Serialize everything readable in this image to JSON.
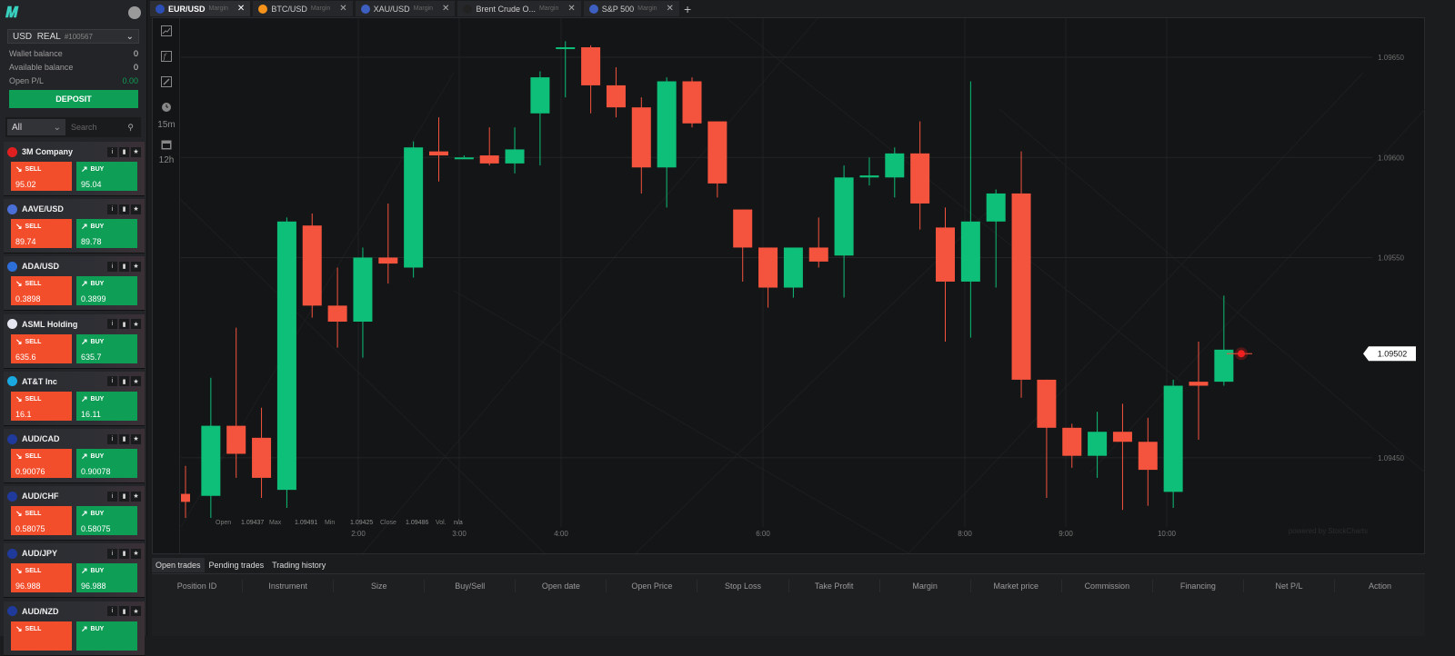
{
  "sidebar": {
    "account": {
      "currency": "USD",
      "type": "REAL",
      "id": "#100567"
    },
    "wallet_balance_label": "Wallet balance",
    "wallet_balance": "0",
    "available_balance_label": "Available balance",
    "available_balance": "0",
    "open_pl_label": "Open P/L",
    "open_pl": "0.00",
    "deposit_label": "DEPOSIT",
    "filter": "All",
    "search_placeholder": "Search",
    "instruments": [
      {
        "name": "3M Company",
        "sell": "95.02",
        "buy": "95.04",
        "flag_color": "#e02020"
      },
      {
        "name": "AAVE/USD",
        "sell": "89.74",
        "buy": "89.78",
        "flag_color": "#4a6fd6"
      },
      {
        "name": "ADA/USD",
        "sell": "0.3898",
        "buy": "0.3899",
        "flag_color": "#2c6fd9"
      },
      {
        "name": "ASML Holding",
        "sell": "635.6",
        "buy": "635.7",
        "flag_color": "#e6e6f0"
      },
      {
        "name": "AT&T Inc",
        "sell": "16.1",
        "buy": "16.11",
        "flag_color": "#19a8e0"
      },
      {
        "name": "AUD/CAD",
        "sell": "0.90076",
        "buy": "0.90078",
        "flag_color": "#1f3a9a"
      },
      {
        "name": "AUD/CHF",
        "sell": "0.58075",
        "buy": "0.58075",
        "flag_color": "#1f3a9a"
      },
      {
        "name": "AUD/JPY",
        "sell": "96.988",
        "buy": "96.988",
        "flag_color": "#1f3a9a"
      },
      {
        "name": "AUD/NZD",
        "sell": "",
        "buy": "",
        "flag_color": "#1f3a9a"
      }
    ],
    "sell_label": "SELL",
    "buy_label": "BUY"
  },
  "tabs": [
    {
      "label": "EUR/USD",
      "sub": "Margin",
      "flag_color": "#2c4fb5",
      "active": true
    },
    {
      "label": "BTC/USD",
      "sub": "Margin",
      "flag_color": "#f7931a",
      "active": false
    },
    {
      "label": "XAU/USD",
      "sub": "Margin",
      "flag_color": "#3c5fc0",
      "active": false
    },
    {
      "label": "Brent Crude O...",
      "sub": "Margin",
      "flag_color": "#222",
      "active": false
    },
    {
      "label": "S&P 500",
      "sub": "Margin",
      "flag_color": "#3c5fc0",
      "active": false
    }
  ],
  "toolbar": {
    "interval_1": "15m",
    "interval_2": "12h"
  },
  "chart_data": {
    "type": "candlestick",
    "y_ticks": [
      1.0945,
      1.0955,
      1.096,
      1.0965
    ],
    "y_tick_labels": [
      "1.09450",
      "1.09550",
      "1.09600",
      "1.09650"
    ],
    "x_ticks": [
      "2:00",
      "3:00",
      "4:00",
      "6:00",
      "8:00",
      "9:00",
      "10:00"
    ],
    "current_price": "1.09502",
    "ohlc_labels": {
      "open": "Open",
      "max": "Max",
      "min": "Min",
      "close": "Close",
      "vol": "Vol."
    },
    "ohlc_values": {
      "open": "1.09437",
      "max": "1.09491",
      "min": "1.09425",
      "close": "1.09486",
      "vol": "n/a"
    },
    "watermark": "powered by StockCharts",
    "candles": [
      {
        "o": 1.09432,
        "h": 1.09446,
        "l": 1.0942,
        "c": 1.09428
      },
      {
        "o": 1.09431,
        "h": 1.0949,
        "l": 1.0942,
        "c": 1.09466
      },
      {
        "o": 1.09466,
        "h": 1.09515,
        "l": 1.0944,
        "c": 1.09452
      },
      {
        "o": 1.0946,
        "h": 1.09475,
        "l": 1.0943,
        "c": 1.0944
      },
      {
        "o": 1.09434,
        "h": 1.0957,
        "l": 1.09425,
        "c": 1.09568
      },
      {
        "o": 1.09566,
        "h": 1.09572,
        "l": 1.0952,
        "c": 1.09526
      },
      {
        "o": 1.09526,
        "h": 1.09545,
        "l": 1.09505,
        "c": 1.09518
      },
      {
        "o": 1.09518,
        "h": 1.09555,
        "l": 1.095,
        "c": 1.0955
      },
      {
        "o": 1.0955,
        "h": 1.09577,
        "l": 1.09537,
        "c": 1.09547
      },
      {
        "o": 1.09545,
        "h": 1.09608,
        "l": 1.0954,
        "c": 1.09605
      },
      {
        "o": 1.09603,
        "h": 1.0962,
        "l": 1.09588,
        "c": 1.09601
      },
      {
        "o": 1.096,
        "h": 1.09601,
        "l": 1.096,
        "c": 1.096
      },
      {
        "o": 1.09601,
        "h": 1.09615,
        "l": 1.09596,
        "c": 1.09597
      },
      {
        "o": 1.09597,
        "h": 1.09615,
        "l": 1.09592,
        "c": 1.09604
      },
      {
        "o": 1.09622,
        "h": 1.09643,
        "l": 1.09596,
        "c": 1.0964
      },
      {
        "o": 1.09655,
        "h": 1.09658,
        "l": 1.0963,
        "c": 1.09655
      },
      {
        "o": 1.09655,
        "h": 1.09656,
        "l": 1.09622,
        "c": 1.09636
      },
      {
        "o": 1.09636,
        "h": 1.09645,
        "l": 1.0962,
        "c": 1.09625
      },
      {
        "o": 1.09625,
        "h": 1.0963,
        "l": 1.09582,
        "c": 1.09595
      },
      {
        "o": 1.09595,
        "h": 1.0964,
        "l": 1.09575,
        "c": 1.09638
      },
      {
        "o": 1.09638,
        "h": 1.0964,
        "l": 1.09615,
        "c": 1.09617
      },
      {
        "o": 1.09618,
        "h": 1.09618,
        "l": 1.0958,
        "c": 1.09587
      },
      {
        "o": 1.09574,
        "h": 1.09574,
        "l": 1.09538,
        "c": 1.09555
      },
      {
        "o": 1.09555,
        "h": 1.09555,
        "l": 1.09525,
        "c": 1.09535
      },
      {
        "o": 1.09535,
        "h": 1.09555,
        "l": 1.0953,
        "c": 1.09555
      },
      {
        "o": 1.09555,
        "h": 1.0957,
        "l": 1.09545,
        "c": 1.09548
      },
      {
        "o": 1.09551,
        "h": 1.09596,
        "l": 1.0953,
        "c": 1.0959
      },
      {
        "o": 1.0959,
        "h": 1.096,
        "l": 1.09586,
        "c": 1.09591
      },
      {
        "o": 1.0959,
        "h": 1.09605,
        "l": 1.0958,
        "c": 1.09602
      },
      {
        "o": 1.09602,
        "h": 1.09618,
        "l": 1.09564,
        "c": 1.09577
      },
      {
        "o": 1.09565,
        "h": 1.09575,
        "l": 1.09508,
        "c": 1.09538
      },
      {
        "o": 1.09538,
        "h": 1.09638,
        "l": 1.0951,
        "c": 1.09568
      },
      {
        "o": 1.09568,
        "h": 1.09584,
        "l": 1.09535,
        "c": 1.09582
      },
      {
        "o": 1.09582,
        "h": 1.09603,
        "l": 1.0948,
        "c": 1.09489
      },
      {
        "o": 1.09489,
        "h": 1.09489,
        "l": 1.0943,
        "c": 1.09465
      },
      {
        "o": 1.09465,
        "h": 1.09467,
        "l": 1.09445,
        "c": 1.09451
      },
      {
        "o": 1.09451,
        "h": 1.09473,
        "l": 1.0944,
        "c": 1.09463
      },
      {
        "o": 1.09463,
        "h": 1.09477,
        "l": 1.09424,
        "c": 1.09458
      },
      {
        "o": 1.09458,
        "h": 1.0947,
        "l": 1.09426,
        "c": 1.09444
      },
      {
        "o": 1.09433,
        "h": 1.09489,
        "l": 1.09425,
        "c": 1.09486
      },
      {
        "o": 1.09488,
        "h": 1.09508,
        "l": 1.09459,
        "c": 1.09486
      },
      {
        "o": 1.09488,
        "h": 1.09531,
        "l": 1.09486,
        "c": 1.09504
      }
    ]
  },
  "bottom_tabs": [
    "Open trades",
    "Pending trades",
    "Trading history"
  ],
  "table_headers": [
    "Position ID",
    "Instrument",
    "Size",
    "Buy/Sell",
    "Open date",
    "Open Price",
    "Stop Loss",
    "Take Profit",
    "Margin",
    "Market price",
    "Commission",
    "Financing",
    "Net P/L",
    "Action"
  ],
  "colors": {
    "up": "#0dbf78",
    "down": "#f4533e",
    "accent_green": "#0f9e56",
    "accent_red": "#f24e2c"
  }
}
